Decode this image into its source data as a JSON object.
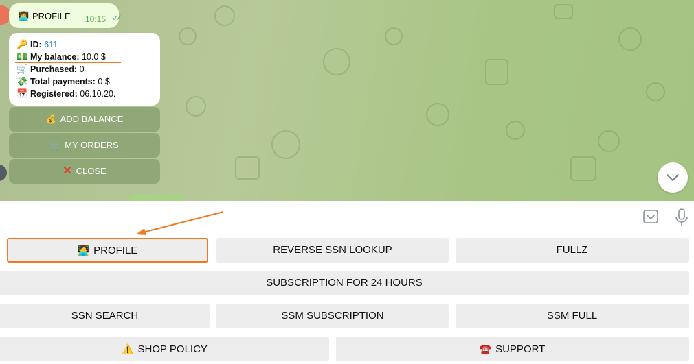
{
  "colors": {
    "annotation": "#f07a24",
    "chat_bg": "#b2c892",
    "outgoing_bubble": "#effdde",
    "keyboard_button": "#ededed"
  },
  "outgoing_message": {
    "icon": "person-at-computer-emoji",
    "emoji": "🧑‍💻",
    "text": "PROFILE",
    "time": "10:15",
    "status_icon": "double-check-icon",
    "status_glyph": "✓✓"
  },
  "profile_message": {
    "lines": [
      {
        "icon": "key-emoji",
        "emoji": "🔑",
        "label": "ID:",
        "value": "611"
      },
      {
        "icon": "money-emoji",
        "emoji": "💵",
        "label": "My balance:",
        "value": "10.0 $"
      },
      {
        "icon": "cart-emoji",
        "emoji": "🛒",
        "label": "Purchased:",
        "value": "0"
      },
      {
        "icon": "money-wings-emoji",
        "emoji": "💸",
        "label": "Total payments:",
        "value": "0 $"
      },
      {
        "icon": "calendar-emoji",
        "emoji": "📅",
        "label": "Registered:",
        "value": "06.10.20."
      }
    ]
  },
  "inline_buttons": [
    {
      "icon": "coin-emoji",
      "emoji": "💰",
      "label": "ADD BALANCE"
    },
    {
      "icon": "cart-emoji",
      "emoji": "🛒",
      "label": "MY ORDERS"
    },
    {
      "icon": "cross-mark-icon",
      "emoji": "✕",
      "label": "CLOSE"
    }
  ],
  "reply_keyboard": {
    "rows": [
      [
        {
          "icon": "person-at-computer-emoji",
          "emoji": "🧑‍💻",
          "label": "PROFILE",
          "highlighted": true
        },
        {
          "label": "REVERSE SSN LOOKUP"
        },
        {
          "label": "FULLZ"
        }
      ],
      [
        {
          "label": "SUBSCRIPTION FOR 24 HOURS"
        }
      ],
      [
        {
          "label": "SSN SEARCH"
        },
        {
          "label": "SSM SUBSCRIPTION"
        },
        {
          "label": "SSM FULL"
        }
      ],
      [
        {
          "icon": "warning-emoji",
          "emoji": "⚠️",
          "label": "SHOP POLICY"
        },
        {
          "icon": "telephone-emoji",
          "emoji": "☎️",
          "label": "SUPPORT"
        }
      ]
    ]
  }
}
